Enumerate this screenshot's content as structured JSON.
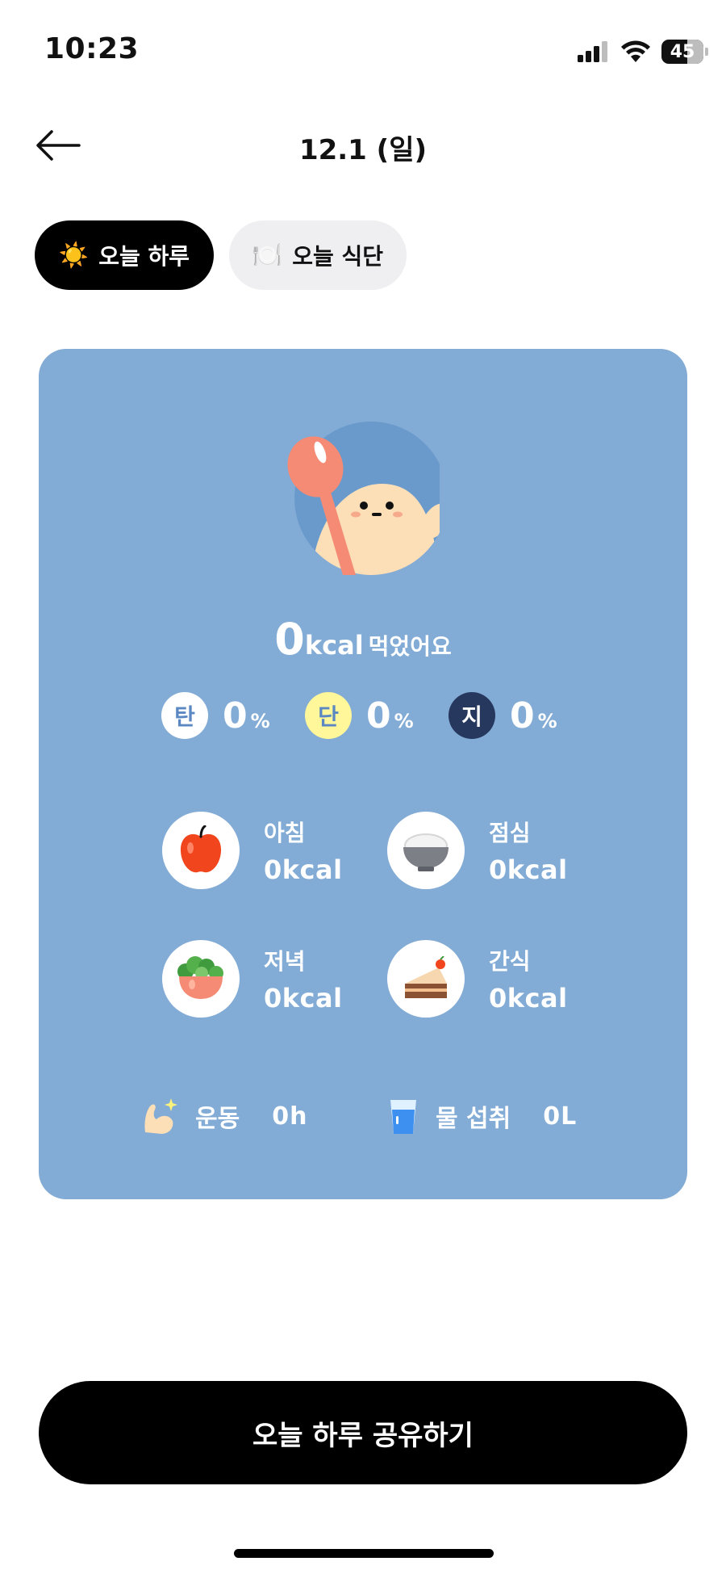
{
  "status_bar": {
    "time": "10:23",
    "battery": "45"
  },
  "header": {
    "title": "12.1 (일)"
  },
  "tabs": [
    {
      "label": "오늘 하루",
      "icon": "sun-icon",
      "emoji": "☀️",
      "active": true
    },
    {
      "label": "오늘 식단",
      "icon": "plate-icon",
      "emoji": "🍽️",
      "active": false
    }
  ],
  "summary": {
    "kcal_value": "0",
    "kcal_unit": "kcal",
    "kcal_text": "먹었어요"
  },
  "macros": [
    {
      "badge": "탄",
      "value": "0",
      "unit": "%",
      "badge_bg": "#ffffff",
      "badge_color": "#5b88c3"
    },
    {
      "badge": "단",
      "value": "0",
      "unit": "%",
      "badge_bg": "#fff79a",
      "badge_color": "#5b88c3"
    },
    {
      "badge": "지",
      "value": "0",
      "unit": "%",
      "badge_bg": "#26385e",
      "badge_color": "#ffffff"
    }
  ],
  "meals": [
    {
      "label": "아침",
      "kcal": "0kcal",
      "icon": "apple-icon"
    },
    {
      "label": "점심",
      "kcal": "0kcal",
      "icon": "rice-bowl-icon"
    },
    {
      "label": "저녁",
      "kcal": "0kcal",
      "icon": "salad-bowl-icon"
    },
    {
      "label": "간식",
      "kcal": "0kcal",
      "icon": "cake-icon"
    }
  ],
  "exercise": {
    "label": "운동",
    "value": "0h",
    "icon": "muscle-icon"
  },
  "water": {
    "label": "물 섭취",
    "value": "0L",
    "icon": "water-glass-icon"
  },
  "share_button": {
    "label": "오늘 하루 공유하기"
  },
  "colors": {
    "card_bg": "#82abd6",
    "button_bg": "#000000",
    "accent_orange": "#f47f62"
  }
}
